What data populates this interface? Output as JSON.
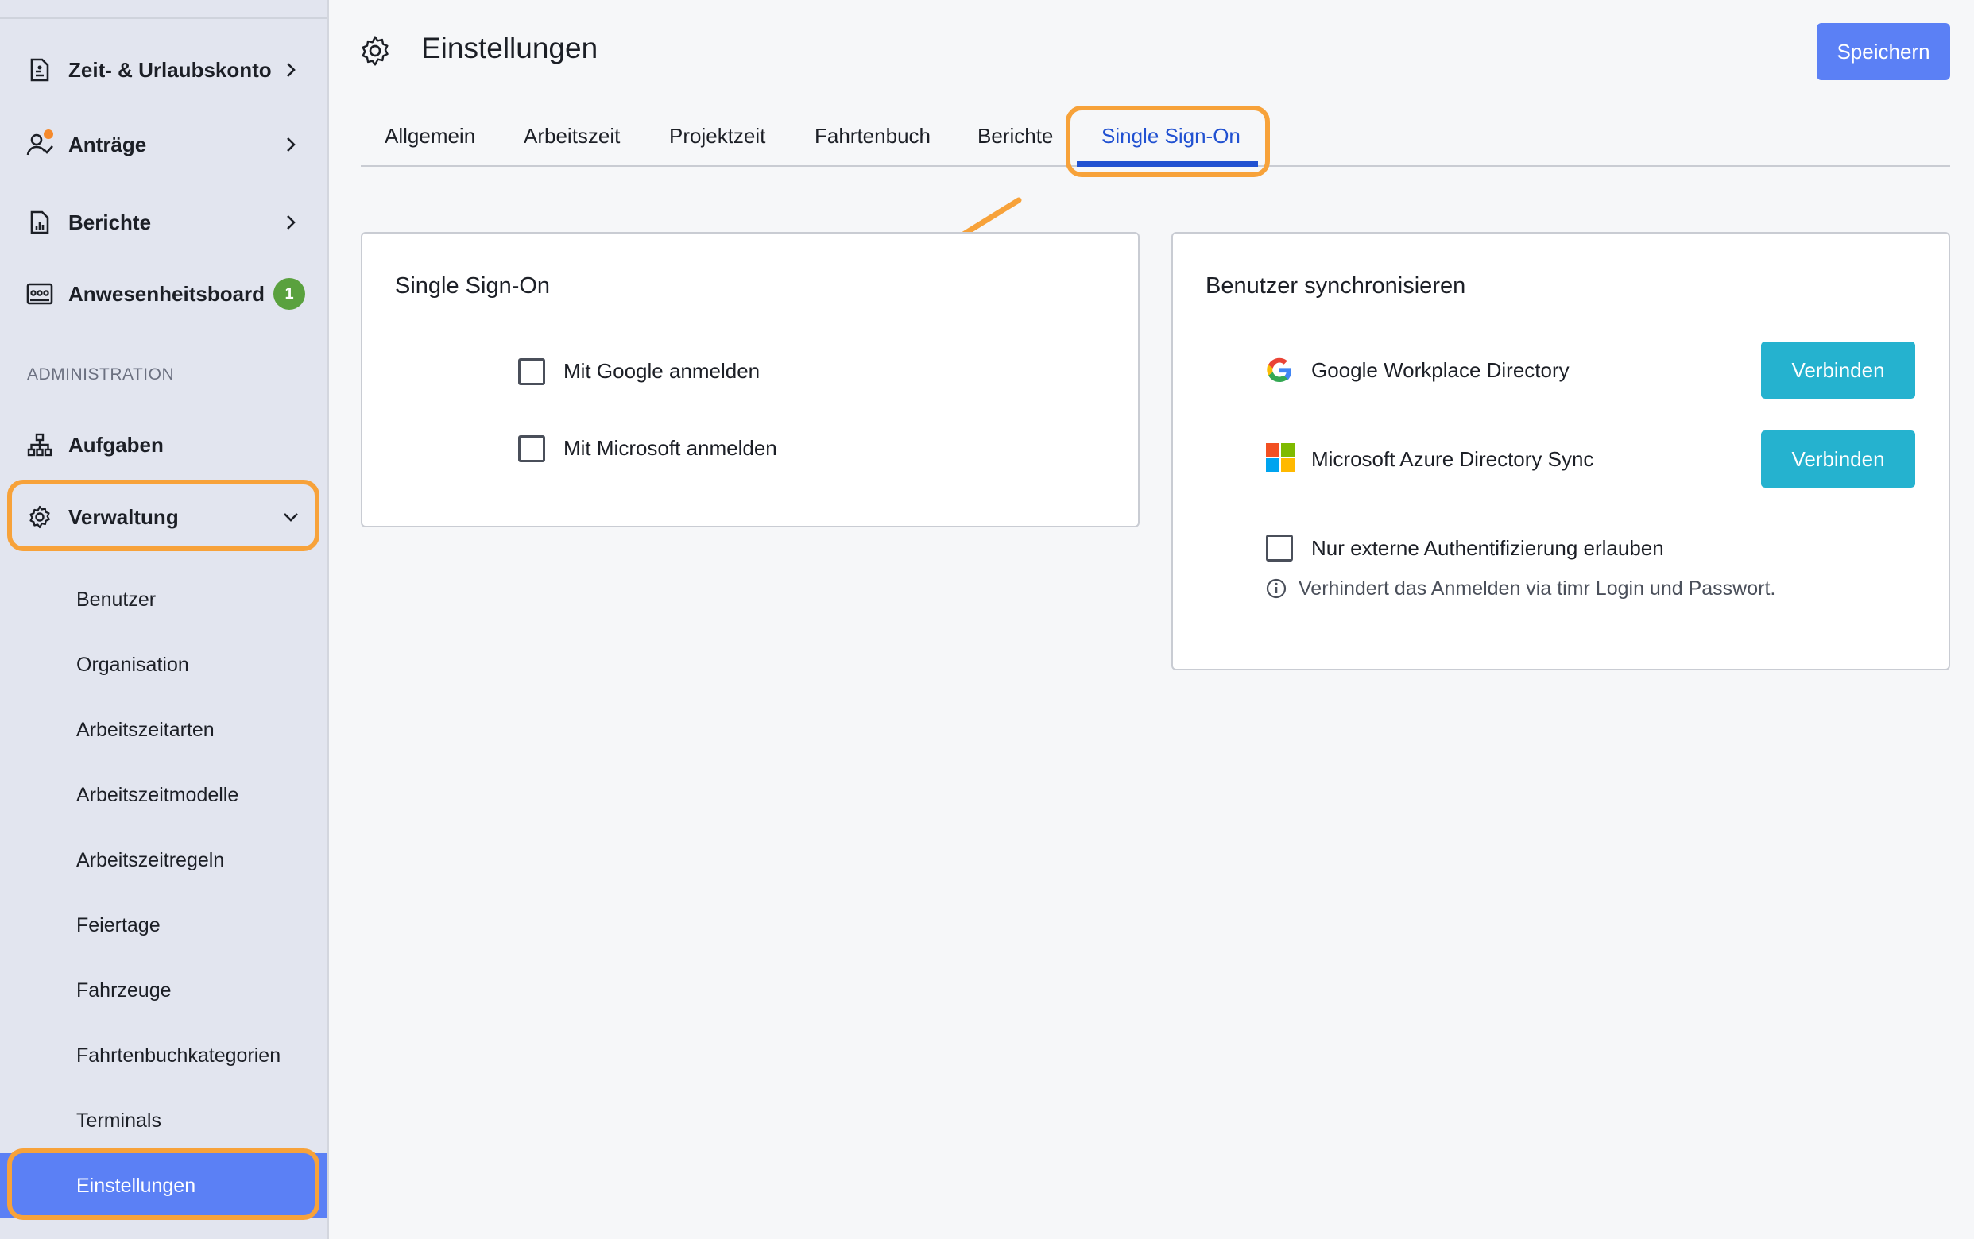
{
  "sidebar": {
    "items": [
      {
        "label": "Zeit- & Urlaubskonto",
        "icon": "document-icon"
      },
      {
        "label": "Anträge",
        "icon": "user-check-icon"
      },
      {
        "label": "Berichte",
        "icon": "report-icon"
      },
      {
        "label": "Anwesenheitsboard",
        "icon": "attendance-board-icon",
        "badge": "1"
      }
    ],
    "section_label": "ADMINISTRATION",
    "admin_items": [
      {
        "label": "Aufgaben",
        "icon": "hierarchy-icon"
      },
      {
        "label": "Verwaltung",
        "icon": "gear-icon"
      }
    ],
    "sub_items": [
      "Benutzer",
      "Organisation",
      "Arbeitszeitarten",
      "Arbeitszeitmodelle",
      "Arbeitszeitregeln",
      "Feiertage",
      "Fahrzeuge",
      "Fahrtenbuchkategorien",
      "Terminals",
      "Einstellungen"
    ],
    "active_sub_item": "Einstellungen"
  },
  "header": {
    "title": "Einstellungen",
    "save_label": "Speichern"
  },
  "tabs": [
    "Allgemein",
    "Arbeitszeit",
    "Projektzeit",
    "Fahrtenbuch",
    "Berichte",
    "Single Sign-On"
  ],
  "active_tab": "Single Sign-On",
  "sso_card": {
    "title": "Single Sign-On",
    "options": [
      "Mit Google anmelden",
      "Mit Microsoft anmelden"
    ]
  },
  "sync_card": {
    "title": "Benutzer synchronisieren",
    "services": [
      {
        "label": "Google Workplace Directory",
        "icon": "google-icon",
        "button": "Verbinden"
      },
      {
        "label": "Microsoft Azure Directory Sync",
        "icon": "microsoft-icon",
        "button": "Verbinden"
      }
    ],
    "external_auth_label": "Nur externe Authentifizierung erlauben",
    "hint": "Verhindert das Anmelden via timr Login und Passwort."
  },
  "colors": {
    "primary": "#5b80f5",
    "accent_tab": "#2151d1",
    "connect": "#25b2cf",
    "highlight": "#f7a23a",
    "badge": "#5aa13e"
  }
}
